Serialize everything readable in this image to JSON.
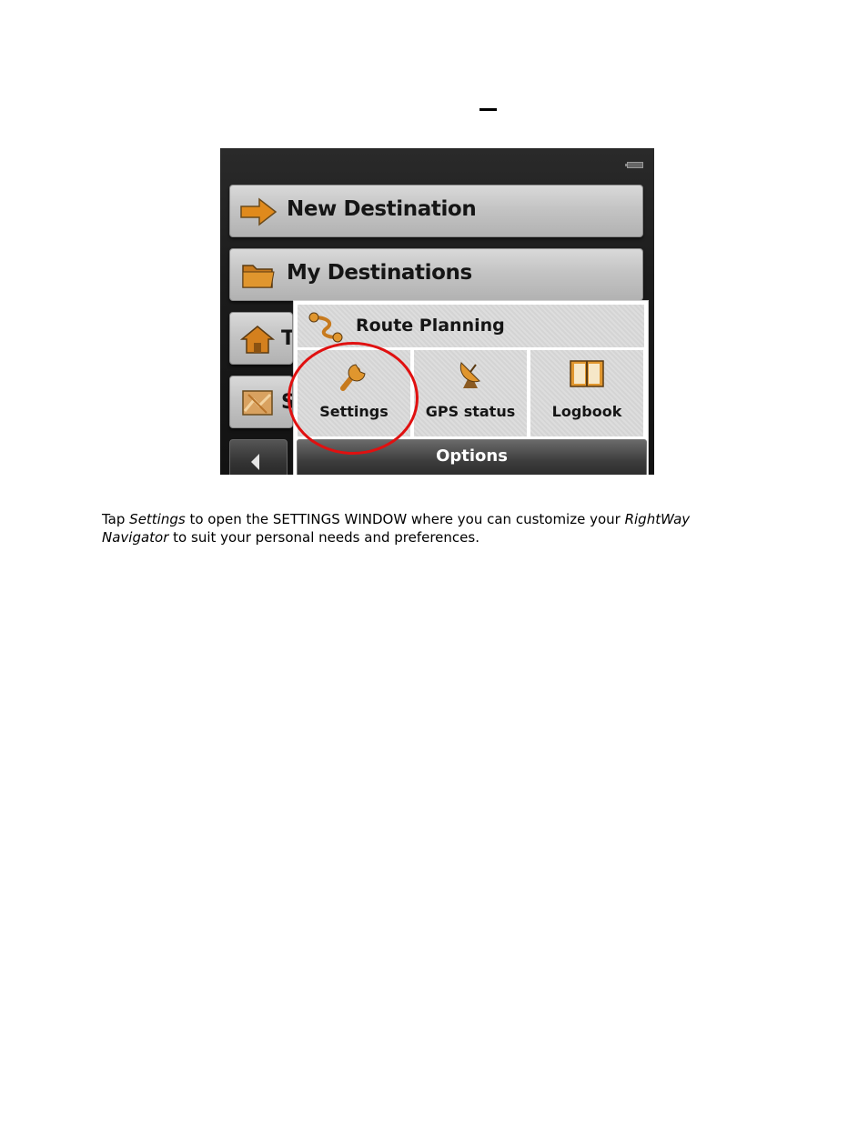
{
  "page_marker": "",
  "screen": {
    "buttons": {
      "new_destination": "New Destination",
      "my_destinations": "My Destinations",
      "third_stub": "T",
      "fourth_stub": "S"
    },
    "popup": {
      "route_planning": "Route Planning",
      "cells": [
        "Settings",
        "GPS status",
        "Logbook"
      ],
      "options": "Options"
    },
    "icons": [
      "battery-icon",
      "arrow-right-icon",
      "folder-icon",
      "home-icon",
      "map-icon",
      "back-arrow-icon",
      "route-icon",
      "wrench-icon",
      "satellite-icon",
      "logbook-icon"
    ],
    "highlight_color": "#e01010"
  },
  "caption": {
    "t1": "Tap ",
    "t2": "Settings",
    "t3": " to open the SETTINGS WINDOW where you can customize your ",
    "t4": "RightWay Navigator",
    "t5": " to suit your personal needs and preferences."
  }
}
